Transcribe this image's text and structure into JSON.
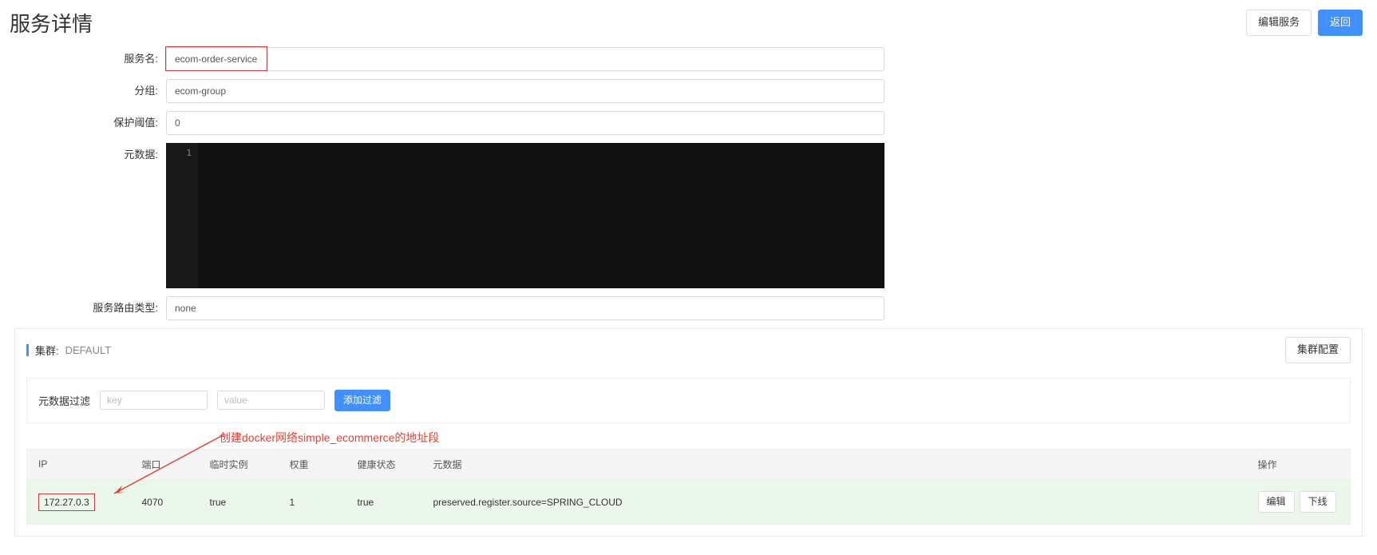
{
  "page": {
    "title": "服务详情",
    "editServiceBtn": "编辑服务",
    "backBtn": "返回"
  },
  "form": {
    "serviceNameLabel": "服务名:",
    "serviceName": "ecom-order-service",
    "groupLabel": "分组:",
    "group": "ecom-group",
    "protectThresholdLabel": "保护阈值:",
    "protectThreshold": "0",
    "metadataLabel": "元数据:",
    "code_line_no": "1",
    "code_line": "",
    "routeTypeLabel": "服务路由类型:",
    "routeType": "none"
  },
  "cluster": {
    "titleLabel": "集群:",
    "name": "DEFAULT",
    "configBtn": "集群配置"
  },
  "filter": {
    "label": "元数据过滤",
    "keyPlaceholder": "key",
    "valuePlaceholder": "value",
    "addBtn": "添加过滤"
  },
  "annotation": {
    "text": "创建docker网络simple_ecommerce的地址段"
  },
  "table": {
    "headers": {
      "ip": "IP",
      "port": "端口",
      "temp": "临时实例",
      "weight": "权重",
      "health": "健康状态",
      "metadata": "元数据",
      "action": "操作"
    },
    "row": {
      "ip": "172.27.0.3",
      "port": "4070",
      "temp": "true",
      "weight": "1",
      "health": "true",
      "metadata": "preserved.register.source=SPRING_CLOUD",
      "editBtn": "编辑",
      "offlineBtn": "下线"
    }
  }
}
